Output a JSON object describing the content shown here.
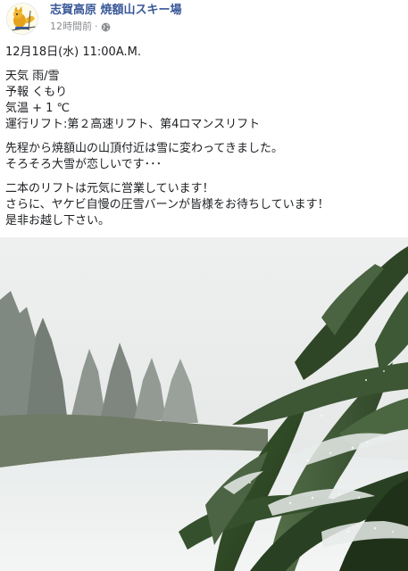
{
  "page": {
    "name": "志賀高原 焼額山スキー場",
    "time": "12時間前",
    "separator": "·",
    "privacy_icon": "globe-icon",
    "avatar_icon": "mascot-logo"
  },
  "post": {
    "date_line": "12月18日(水) 11:00A.M.",
    "weather": "天気 雨/雪",
    "forecast": "予報 くもり",
    "temperature": "気温 + 1 ℃",
    "lifts": "運行リフト:第２高速リフト、第4ロマンスリフト",
    "para2_line1": "先程から焼額山の山頂付近は雪に変わってきました。",
    "para2_line2": "そろそろ大雪が恋しいです･･･",
    "para3_line1": "二本のリフトは元気に営業しています！",
    "para3_line2": "さらに、ヤケビ自慢の圧雪バーンが皆様をお待ちしています！",
    "para3_line3": "是非お越し下さい。"
  },
  "photo": {
    "subject": "snow-dusted bamboo leaves with foggy snowy slope and trees"
  },
  "colors": {
    "link": "#385898",
    "text": "#1c1e21",
    "meta": "#8a8d91"
  }
}
